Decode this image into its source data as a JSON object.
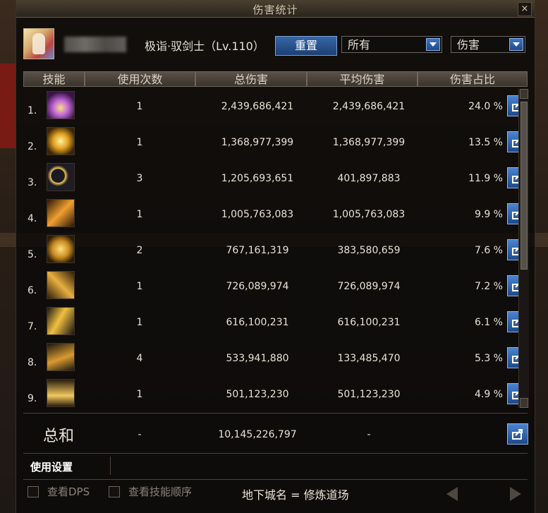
{
  "window": {
    "title": "伤害统计",
    "close_label": "×"
  },
  "character": {
    "name": "极诣·驭剑士（Lv.110）"
  },
  "controls": {
    "reset_label": "重置",
    "filter_value": "所有",
    "metric_value": "伤害"
  },
  "table": {
    "headers": [
      "技能",
      "使用次数",
      "总伤害",
      "平均伤害",
      "伤害占比"
    ],
    "rows": [
      {
        "index": "1.",
        "uses": "1",
        "total": "2,439,686,421",
        "avg": "2,439,686,421",
        "pct": "24.0 %",
        "icon": "skill-icon-purple-burst"
      },
      {
        "index": "2.",
        "uses": "1",
        "total": "1,368,977,399",
        "avg": "1,368,977,399",
        "pct": "13.5 %",
        "icon": "skill-icon-gold-wings"
      },
      {
        "index": "3.",
        "uses": "3",
        "total": "1,205,693,651",
        "avg": "401,897,883",
        "pct": "11.9 %",
        "icon": "skill-icon-crescent-moon"
      },
      {
        "index": "4.",
        "uses": "1",
        "total": "1,005,763,083",
        "avg": "1,005,763,083",
        "pct": "9.9 %",
        "icon": "skill-icon-flame-slash"
      },
      {
        "index": "5.",
        "uses": "2",
        "total": "767,161,319",
        "avg": "383,580,659",
        "pct": "7.6 %",
        "icon": "skill-icon-gold-swirl"
      },
      {
        "index": "6.",
        "uses": "1",
        "total": "726,089,974",
        "avg": "726,089,974",
        "pct": "7.2 %",
        "icon": "skill-icon-sword-cross"
      },
      {
        "index": "7.",
        "uses": "1",
        "total": "616,100,231",
        "avg": "616,100,231",
        "pct": "6.1 %",
        "icon": "skill-icon-lightning-blades"
      },
      {
        "index": "8.",
        "uses": "4",
        "total": "533,941,880",
        "avg": "133,485,470",
        "pct": "5.3 %",
        "icon": "skill-icon-triple-slash"
      },
      {
        "index": "9.",
        "uses": "1",
        "total": "501,123,230",
        "avg": "501,123,230",
        "pct": "4.9 %",
        "icon": "skill-icon-sword-rain"
      }
    ]
  },
  "summary": {
    "label": "总和",
    "uses": "-",
    "total": "10,145,226,797",
    "avg": "-"
  },
  "settings": {
    "tab_label": "使用设置"
  },
  "footer": {
    "dps_label": "查看DPS",
    "order_label": "查看技能顺序",
    "dungeon_text": "地下城名 = 修炼道场"
  },
  "colors": {
    "accent_blue": "#2a5aa0",
    "panel_bg": "#0c0a09",
    "header_gold": "#c9b07a"
  }
}
